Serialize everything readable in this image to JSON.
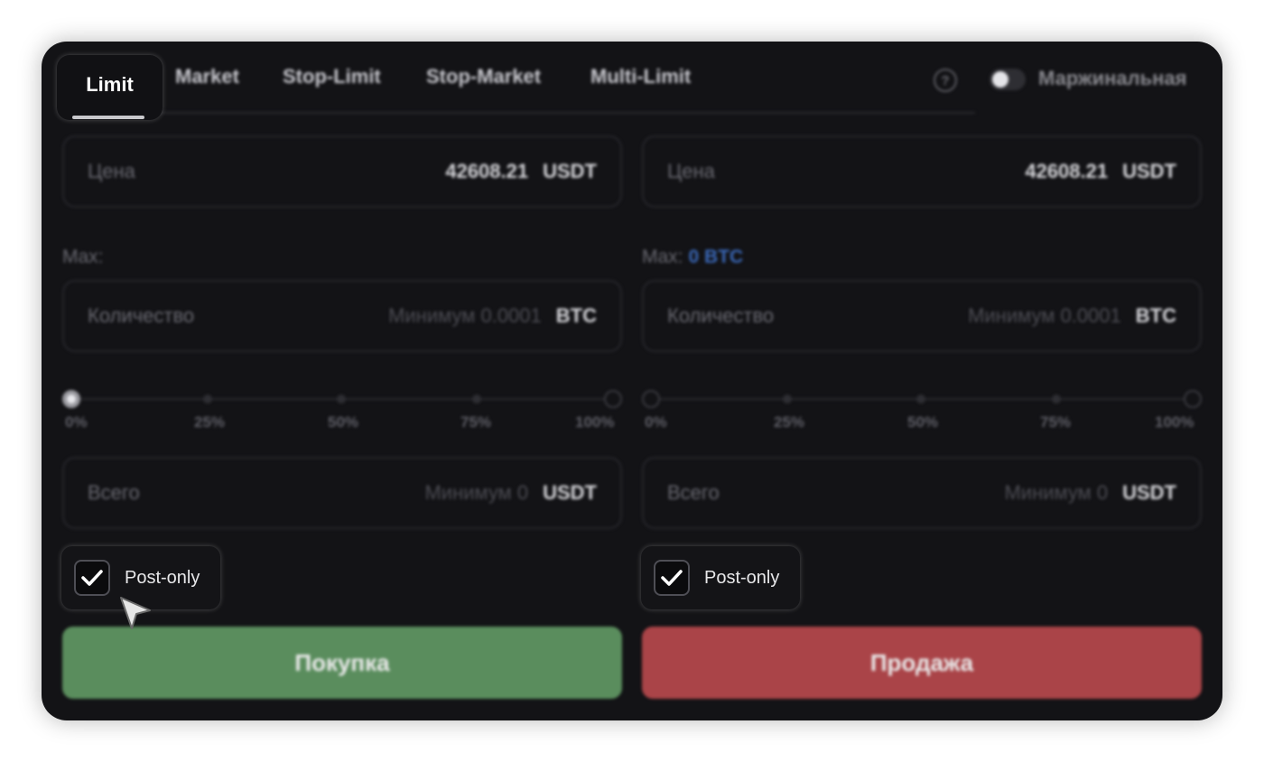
{
  "tabs": {
    "active": "Limit",
    "items": [
      "Market",
      "Stop-Limit",
      "Stop-Market",
      "Multi-Limit"
    ]
  },
  "help": {
    "icon": "help-circle-icon",
    "glyph": "?"
  },
  "margin_toggle": {
    "label": "Маржинальная",
    "enabled": false
  },
  "buy": {
    "price": {
      "label": "Цена",
      "value": "42608.21",
      "unit": "USDT"
    },
    "max": {
      "label": "Max:",
      "value": ""
    },
    "quantity": {
      "label": "Количество",
      "placeholder": "Минимум 0.0001",
      "unit": "BTC"
    },
    "slider": {
      "ticks": [
        "0%",
        "25%",
        "50%",
        "75%",
        "100%"
      ],
      "value_percent": 0
    },
    "total": {
      "label": "Всего",
      "placeholder": "Минимум 0",
      "unit": "USDT"
    },
    "post_only": {
      "label": "Post-only",
      "checked": true
    },
    "button_label": "Покупка"
  },
  "sell": {
    "price": {
      "label": "Цена",
      "value": "42608.21",
      "unit": "USDT"
    },
    "max": {
      "label": "Max:",
      "value": "0 BTC"
    },
    "quantity": {
      "label": "Количество",
      "placeholder": "Минимум 0.0001",
      "unit": "BTC"
    },
    "slider": {
      "ticks": [
        "0%",
        "25%",
        "50%",
        "75%",
        "100%"
      ],
      "value_percent": 0
    },
    "total": {
      "label": "Всего",
      "placeholder": "Минимум 0",
      "unit": "USDT"
    },
    "post_only": {
      "label": "Post-only",
      "checked": true
    },
    "button_label": "Продажа"
  },
  "colors": {
    "background": "#131316",
    "buy": "#5a8d5d",
    "sell": "#aa4448",
    "accent": "#3a68b8"
  }
}
